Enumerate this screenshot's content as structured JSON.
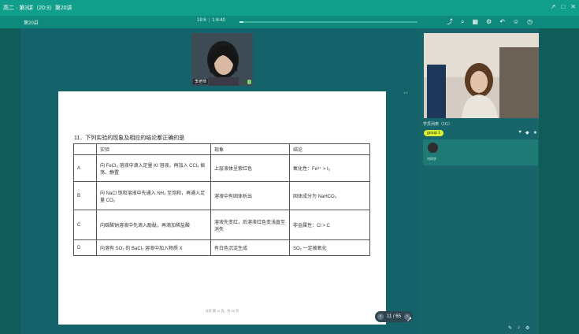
{
  "window": {
    "title": "高二 · 第3讲（20:3）第20讲",
    "controls": [
      "↗",
      "□",
      "✕"
    ],
    "accent": "#119f8b"
  },
  "toolbar": {
    "course_name": "第20讲",
    "time_left": "19:6",
    "time_right": "1:6:40",
    "progress_fraction": 0.02,
    "icons": [
      "share-icon",
      "search-icon",
      "grid-icon",
      "settings-icon",
      "undo-icon",
      "user-icon",
      "clock-icon"
    ]
  },
  "teacher": {
    "name": "李老师"
  },
  "slide": {
    "question": "11．下列实验的现象及相应的结论都正确的是",
    "headers": [
      "",
      "实验",
      "现象",
      "结论"
    ],
    "rows": [
      [
        "A",
        "向 FeCl₃ 溶液中滴入足量 KI 溶液，再加入 CCl₄ 振荡、静置",
        "上层液体呈紫红色",
        "氧化性：Fe³⁺ > I₂"
      ],
      [
        "B",
        "向 NaCl 饱和溶液中先通入 NH₃ 至饱和，再通入足量 CO₂",
        "溶液中有固体析出",
        "固体成分为 NaHCO₃"
      ],
      [
        "C",
        "向碳酸钠溶液中先滴入酚酞，再滴加稀盐酸",
        "溶液先变红，后溶液红色变浅直至消失",
        "非金属性：Cl > C"
      ],
      [
        "D",
        "向溶有 SO₂ 的 BaCl₂ 溶液中加入物质 X",
        "有白色沉淀生成",
        "SO₂ 一定被氧化"
      ]
    ],
    "footer": "化学 第 11 页，共 22 页",
    "side_label": "1:1"
  },
  "pager": {
    "prev": "‹",
    "text": "11 / 65",
    "next": "›"
  },
  "student": {
    "name": "刘同学",
    "member_label": "学员列表（1/1）",
    "group": "group 1",
    "member_name": "刘同学",
    "member_icons": [
      "♥",
      "◆",
      "★"
    ]
  },
  "bottom_icons": [
    "✎",
    "♪",
    "⚙"
  ]
}
